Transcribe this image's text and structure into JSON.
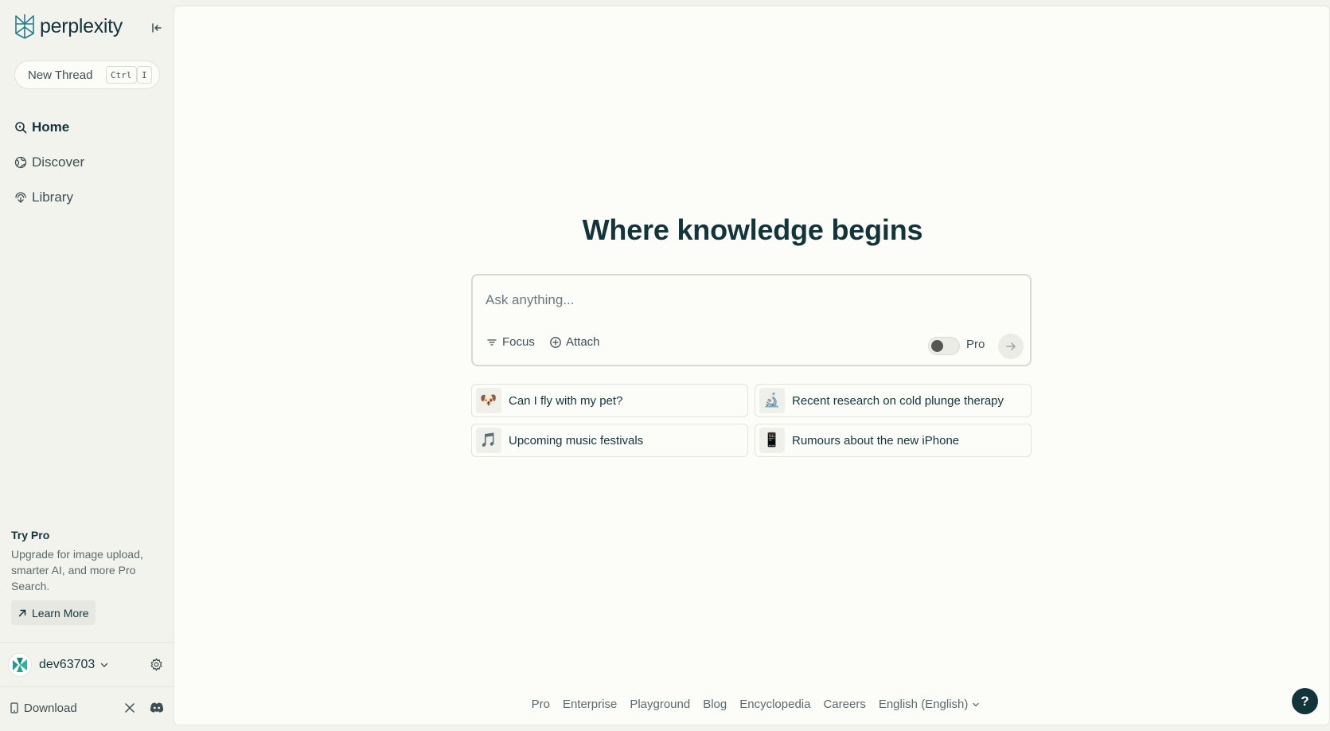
{
  "colors": {
    "brand": "#20808d",
    "text_primary": "#13343b",
    "background_sidebar": "#f3f3ee",
    "background_main": "#fcfcf9"
  },
  "sidebar": {
    "logo_text": "perplexity",
    "new_thread": {
      "label": "New Thread",
      "shortcut": [
        "Ctrl",
        "I"
      ]
    },
    "nav": [
      {
        "label": "Home",
        "icon": "search-icon",
        "active": true
      },
      {
        "label": "Discover",
        "icon": "globe-icon",
        "active": false
      },
      {
        "label": "Library",
        "icon": "library-icon",
        "active": false
      }
    ],
    "try_pro": {
      "title": "Try Pro",
      "description": "Upgrade for image upload, smarter AI, and more Pro Search.",
      "button_label": "Learn More"
    },
    "user": {
      "name": "dev63703"
    },
    "download_label": "Download"
  },
  "main": {
    "heading": "Where knowledge begins",
    "search": {
      "placeholder": "Ask anything...",
      "focus_label": "Focus",
      "attach_label": "Attach",
      "pro_label": "Pro",
      "pro_enabled": false
    },
    "suggestions": [
      {
        "emoji": "🐶",
        "label": "Can I fly with my pet?"
      },
      {
        "emoji": "🔬",
        "label": "Recent research on cold plunge therapy"
      },
      {
        "emoji": "🎵",
        "label": "Upcoming music festivals"
      },
      {
        "emoji": "📱",
        "label": "Rumours about the new iPhone"
      }
    ],
    "footer": {
      "links": [
        "Pro",
        "Enterprise",
        "Playground",
        "Blog",
        "Encyclopedia",
        "Careers"
      ],
      "language": "English (English)"
    },
    "help_label": "?"
  }
}
